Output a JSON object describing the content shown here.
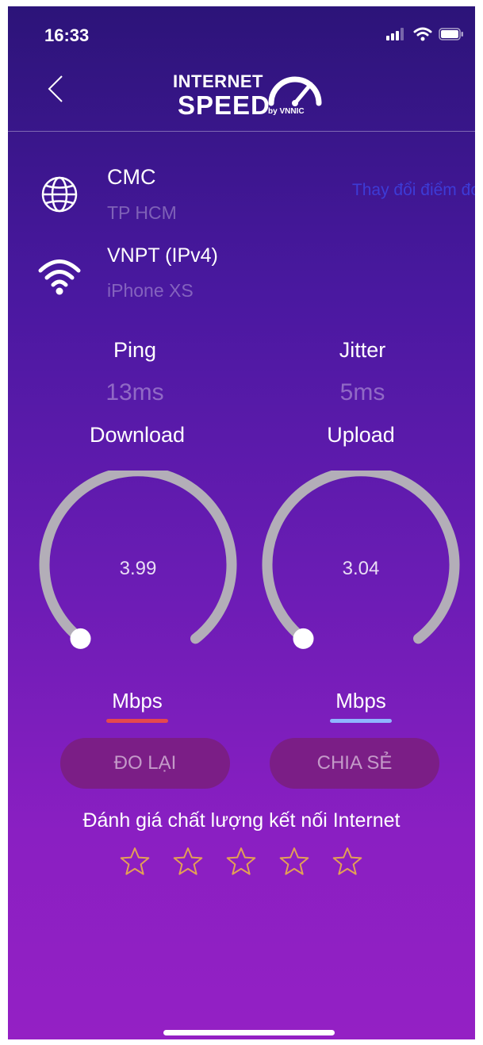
{
  "status": {
    "time": "16:33"
  },
  "header": {
    "logo_line1": "INTERNET",
    "logo_line2": "SPEED",
    "logo_by": "by VNNIC"
  },
  "server": {
    "name": "CMC",
    "location": "TP HCM",
    "change_label": "Thay đổi điểm đo"
  },
  "connection": {
    "isp": "VNPT (IPv4)",
    "device": "iPhone XS"
  },
  "metrics": {
    "ping_label": "Ping",
    "ping_value": "13ms",
    "jitter_label": "Jitter",
    "jitter_value": "5ms",
    "download_label": "Download",
    "upload_label": "Upload"
  },
  "gauges": {
    "download": {
      "value": "3.99",
      "unit": "Mbps",
      "accent": "#e5484d"
    },
    "upload": {
      "value": "3.04",
      "unit": "Mbps",
      "accent": "#8fb6ff"
    }
  },
  "actions": {
    "retest_label": "ĐO LẠI",
    "share_label": "CHIA SẺ"
  },
  "rating": {
    "prompt": "Đánh giá chất lượng kết nối Internet",
    "stars_total": 5,
    "stars_selected": 0
  },
  "colors": {
    "background_top": "#2c1479",
    "background_bottom": "#9420c4",
    "button_bg": "#7b1e86",
    "link": "#3d3bd6"
  }
}
